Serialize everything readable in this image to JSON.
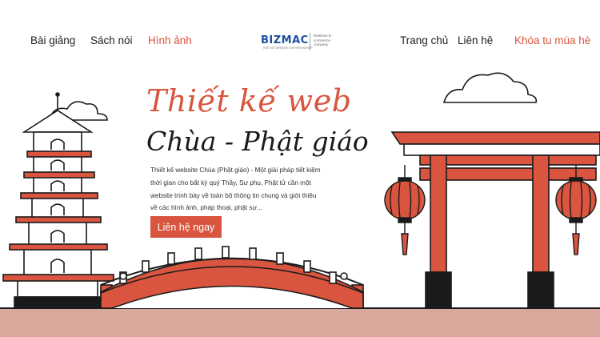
{
  "nav": {
    "left": [
      {
        "label": "Bài giảng"
      },
      {
        "label": "Sách nói"
      },
      {
        "label": "Hình ảnh"
      }
    ],
    "right": [
      {
        "label": "Trang chủ"
      },
      {
        "label": "Liên hệ"
      },
      {
        "label": "Khóa tu mùa hè"
      }
    ]
  },
  "logo": {
    "mark": "BIZMAC",
    "tiny": "THIẾT KẾ WEBSITE CHUYÊN NGHIỆP",
    "tagline": "Rainbow E-commerce company"
  },
  "hero": {
    "title_line1": "Thiết kế web",
    "title_line2": "Chùa - Phật giáo",
    "description": "Thiết kế website Chùa (Phật giáo) - Một giải pháp tiết kiệm thời gian cho bất kỳ quý Thầy, Sư phụ, Phật tử cần một website trình bày về toàn bộ thông tin chung và giới thiệu về các hình ảnh, pháp thoại, phật sự...",
    "cta_label": "Liên hệ ngay"
  },
  "colors": {
    "accent": "#d9553f",
    "ink": "#1a1a1a",
    "ground": "#d8a89c",
    "brand": "#1d4f9f"
  },
  "icons": [
    "pagoda-illustration",
    "torii-gate-illustration",
    "bridge-illustration",
    "lantern-icon",
    "cloud-icon"
  ]
}
